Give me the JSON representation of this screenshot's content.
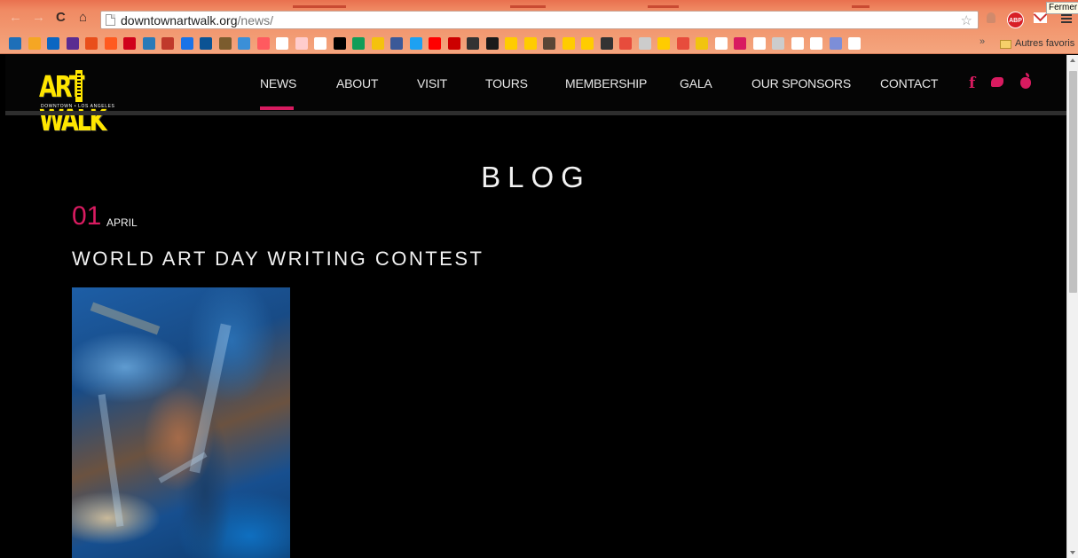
{
  "browser": {
    "back_icon": "arrow-left-icon",
    "forward_icon": "arrow-right-icon",
    "reload_icon": "reload-icon",
    "home_icon": "home-icon",
    "url_domain": "downtownartwalk.org",
    "url_path": "/news/",
    "tooltip": "Fermer",
    "abp_label": "ABP",
    "bookmarks_overflow": "»",
    "bookmarks_folder": "Autres favoris",
    "bookmark_colors": [
      "#1e6fb8",
      "#f5a623",
      "#0a66c2",
      "#5a2c91",
      "#e94e1b",
      "#ff5a1f",
      "#d0021b",
      "#2a7ab8",
      "#c0392b",
      "#1a73e8",
      "#0b5394",
      "#7b5c2e",
      "#3b8fd8",
      "#ff5a5f",
      "#ffffff",
      "#ffcccc",
      "#ffffff",
      "#000000",
      "#0f9d58",
      "#f4c20d",
      "#3b5998",
      "#1da1f2",
      "#ff0000",
      "#cc0000",
      "#333333",
      "#1a1a1a",
      "#ffcc00",
      "#ffcc00",
      "#5a4636",
      "#ffcc00",
      "#ffcc00",
      "#333333",
      "#e74c3c",
      "#cccccc",
      "#ffcc00",
      "#e74c3c",
      "#f1c40f",
      "#ffffff",
      "#d81b60",
      "#ffffff",
      "#cccccc",
      "#ffffff",
      "#ffffff",
      "#7c8ed8",
      "#ffffff"
    ]
  },
  "site": {
    "logo_word": "ART WALK",
    "logo_sub": "DOWNTOWN • LOS ANGELES",
    "nav": [
      "NEWS",
      "ABOUT",
      "VISIT",
      "TOURS",
      "MEMBERSHIP",
      "GALA",
      "OUR SPONSORS",
      "CONTACT"
    ],
    "active_nav": "NEWS",
    "accent_color": "#d81b60",
    "social": {
      "facebook": "f",
      "twitter_icon": "twitter-icon",
      "apple_icon": "apple-icon"
    }
  },
  "main": {
    "title": "BLOG",
    "post": {
      "day": "01",
      "month": "APRIL",
      "title": "WORLD ART DAY WRITING CONTEST"
    }
  }
}
